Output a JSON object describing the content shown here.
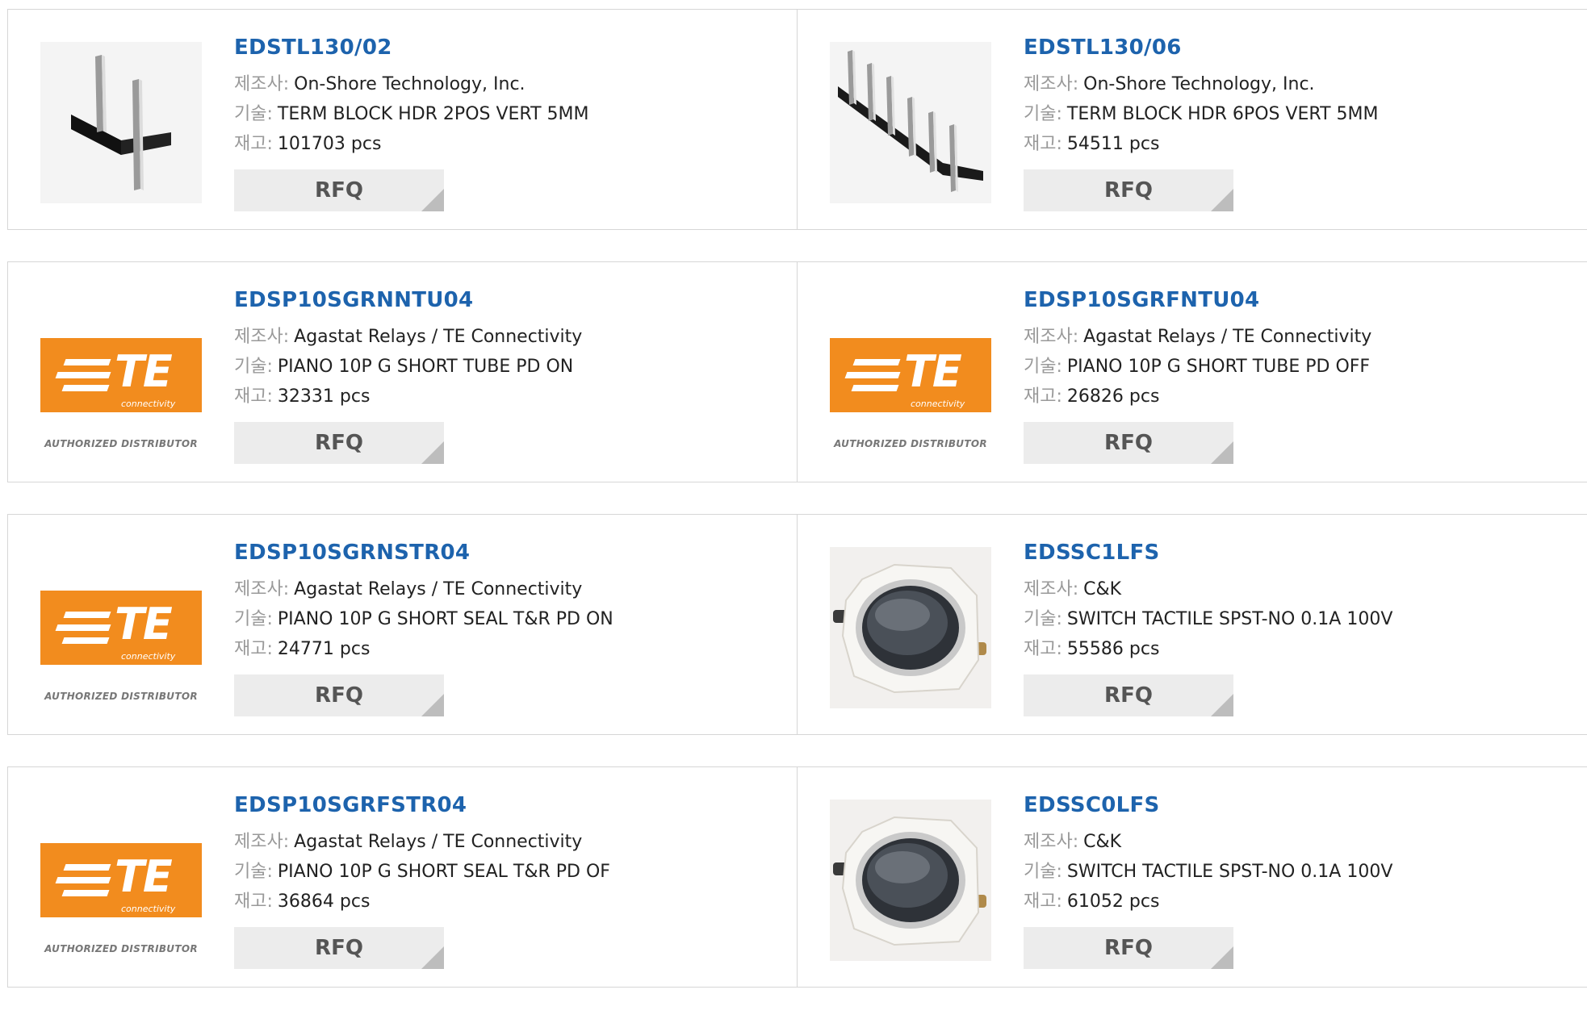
{
  "labels": {
    "manufacturer": "제조사:",
    "description": "기술:",
    "stock": "재고:"
  },
  "rfq_label": "RFQ",
  "te_logo": {
    "letters": "TE",
    "tagline": "connectivity",
    "authorized": "AUTHORIZED DISTRIBUTOR"
  },
  "colors": {
    "part_link": "#1d63ad",
    "te_orange": "#f28c1e",
    "rfq_bg": "#ececec"
  },
  "products": [
    {
      "part": "EDSTL130/02",
      "manufacturer": "On-Shore Technology, Inc.",
      "description": "TERM BLOCK HDR 2POS VERT 5MM",
      "stock": "101703 pcs",
      "image": "header-2pin-icon"
    },
    {
      "part": "EDSTL130/06",
      "manufacturer": "On-Shore Technology, Inc.",
      "description": "TERM BLOCK HDR 6POS VERT 5MM",
      "stock": "54511 pcs",
      "image": "header-6pin-icon"
    },
    {
      "part": "EDSP10SGRNNTU04",
      "manufacturer": "Agastat Relays / TE Connectivity",
      "description": "PIANO 10P G SHORT TUBE PD ON",
      "stock": "32331 pcs",
      "image": "te-logo"
    },
    {
      "part": "EDSP10SGRFNTU04",
      "manufacturer": "Agastat Relays / TE Connectivity",
      "description": "PIANO 10P G SHORT TUBE PD OFF",
      "stock": "26826 pcs",
      "image": "te-logo"
    },
    {
      "part": "EDSP10SGRNSTR04",
      "manufacturer": "Agastat Relays / TE Connectivity",
      "description": "PIANO 10P G SHORT SEAL T&R PD ON",
      "stock": "24771 pcs",
      "image": "te-logo"
    },
    {
      "part": "EDSSC1LFS",
      "manufacturer": "C&K",
      "description": "SWITCH TACTILE SPST-NO 0.1A 100V",
      "stock": "55586 pcs",
      "image": "tactile-switch-icon"
    },
    {
      "part": "EDSP10SGRFSTR04",
      "manufacturer": "Agastat Relays / TE Connectivity",
      "description": "PIANO 10P G SHORT SEAL T&R PD OF",
      "stock": "36864 pcs",
      "image": "te-logo"
    },
    {
      "part": "EDSSC0LFS",
      "manufacturer": "C&K",
      "description": "SWITCH TACTILE SPST-NO 0.1A 100V",
      "stock": "61052 pcs",
      "image": "tactile-switch-icon"
    }
  ]
}
